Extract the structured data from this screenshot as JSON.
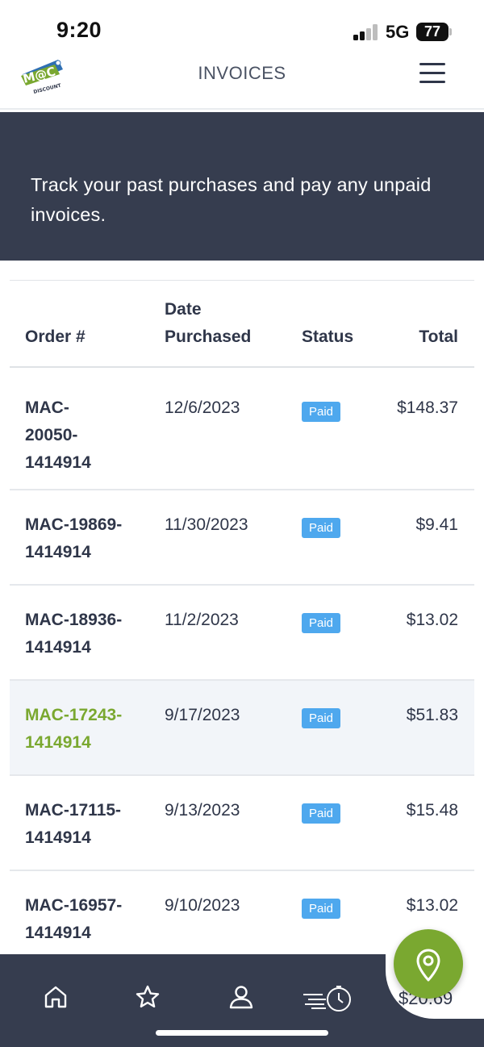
{
  "status_bar": {
    "time": "9:20",
    "network": "5G",
    "battery": "77"
  },
  "header": {
    "title": "INVOICES",
    "logo_name": "mac-discount-logo"
  },
  "banner": {
    "text": "Track your past purchases and pay any unpaid invoices."
  },
  "table": {
    "headers": {
      "order": "Order #",
      "date_line1": "Date",
      "date_line2": "Purchased",
      "status": "Status",
      "total": "Total"
    },
    "rows": [
      {
        "order_lines": [
          "MAC-",
          "20050-",
          "1414914"
        ],
        "date": "12/6/2023",
        "status": "Paid",
        "total": "$148.37"
      },
      {
        "order_lines": [
          "MAC-19869-",
          "1414914"
        ],
        "date": "11/30/2023",
        "status": "Paid",
        "total": "$9.41"
      },
      {
        "order_lines": [
          "MAC-18936-",
          "1414914"
        ],
        "date": "11/2/2023",
        "status": "Paid",
        "total": "$13.02"
      },
      {
        "order_lines": [
          "MAC-17243-",
          "1414914"
        ],
        "date": "9/17/2023",
        "status": "Paid",
        "total": "$51.83",
        "highlighted": true
      },
      {
        "order_lines": [
          "MAC-17115-",
          "1414914"
        ],
        "date": "9/13/2023",
        "status": "Paid",
        "total": "$15.48"
      },
      {
        "order_lines": [
          "MAC-16957-",
          "1414914"
        ],
        "date": "9/10/2023",
        "status": "Paid",
        "total": "$13.02"
      }
    ],
    "peek_total": "$20.69"
  },
  "bottom_nav": {
    "items": [
      {
        "icon": "home-icon"
      },
      {
        "icon": "star-icon"
      },
      {
        "icon": "user-icon"
      },
      {
        "icon": "fast-timer-icon"
      }
    ]
  },
  "fab": {
    "icon": "location-pin-icon"
  },
  "colors": {
    "accent": "#7aa830",
    "dark": "#363d4f",
    "badge": "#4ea8ee",
    "text": "#2f3649"
  }
}
